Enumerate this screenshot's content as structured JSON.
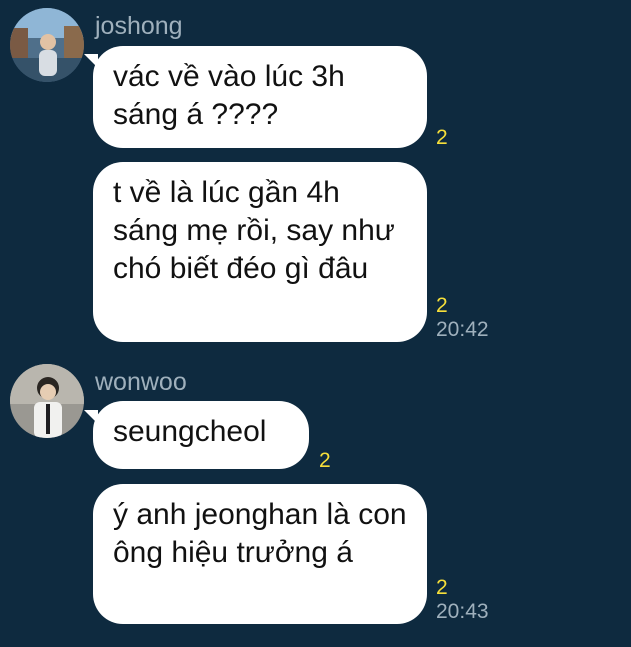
{
  "groups": [
    {
      "sender": "joshong",
      "avatar_icon": "avatar-joshong",
      "messages": [
        {
          "text": "vác về vào lúc 3h sáng á ????",
          "unread": "2",
          "time": ""
        },
        {
          "text": "t về là lúc gần 4h sáng mẹ rồi, say như chó biết đéo gì đâu",
          "unread": "2",
          "time": "20:42"
        }
      ]
    },
    {
      "sender": "wonwoo",
      "avatar_icon": "avatar-wonwoo",
      "messages": [
        {
          "text": "seungcheol",
          "unread": "2",
          "time": ""
        },
        {
          "text": "ý anh jeonghan là con ông hiệu trưởng á",
          "unread": "2",
          "time": "20:43"
        }
      ]
    }
  ],
  "colors": {
    "background": "#0e2a3f",
    "bubble": "#ffffff",
    "unread": "#f6df3a",
    "meta_text": "#9fb0bc"
  }
}
